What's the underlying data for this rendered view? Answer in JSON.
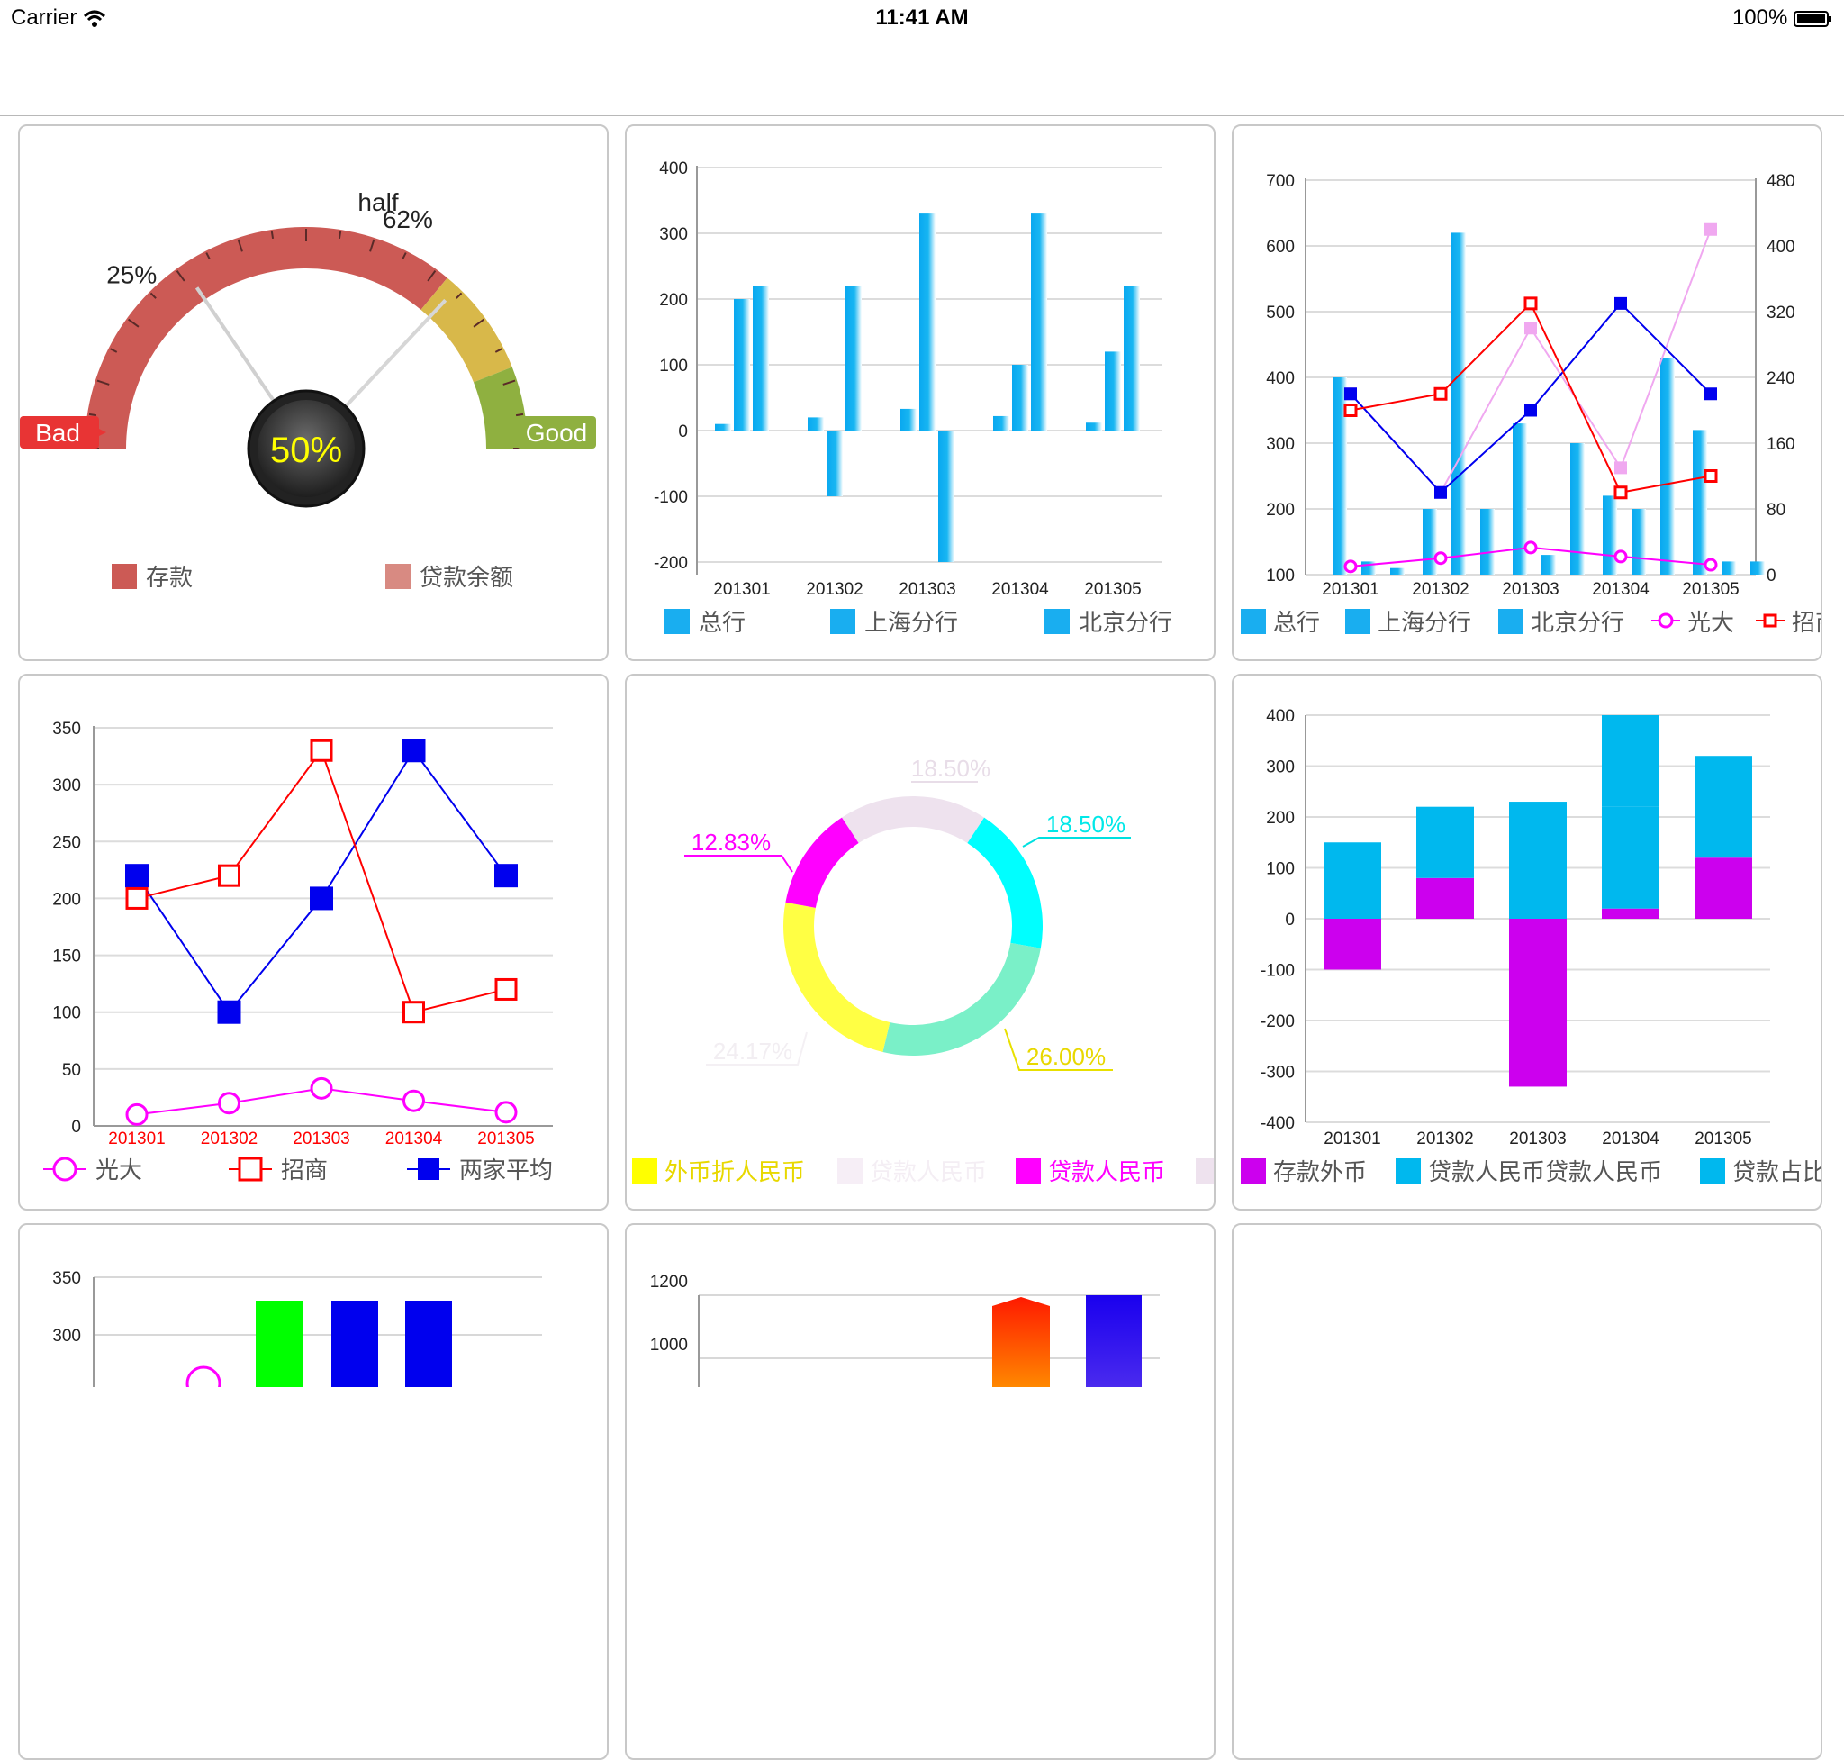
{
  "status_bar": {
    "carrier": "Carrier",
    "time": "11:41 AM",
    "battery": "100%"
  },
  "colors": {
    "gauge_red": "#cc5a55",
    "gauge_yellow": "#d8b84a",
    "gauge_green": "#8fb040",
    "bar_blue": "#19aef0",
    "series_red": "#ff0000",
    "series_blue": "#0000ee",
    "series_magenta": "#ff00ff",
    "series_pink": "#f0a8f0",
    "donut_magenta": "#ff00ff",
    "donut_cyan": "#00ffff",
    "donut_yellow": "#ffff00",
    "stack_purple": "#cc00ee",
    "stack_cyan": "#00b8ee",
    "green": "#00ff00"
  },
  "chart_data": [
    {
      "type": "gauge",
      "value": 50,
      "value_label": "50%",
      "tick_labels": [
        "25%",
        "half",
        "62%"
      ],
      "tick_values": [
        25,
        50,
        62
      ],
      "band_labels": {
        "left": "Bad",
        "right": "Good"
      },
      "legend": [
        "存款",
        "贷款余额"
      ]
    },
    {
      "type": "bar",
      "categories": [
        "201301",
        "201302",
        "201303",
        "201304",
        "201305"
      ],
      "series": [
        {
          "name": "总行",
          "values": [
            10,
            20,
            33,
            22,
            12
          ]
        },
        {
          "name": "上海分行",
          "values": [
            200,
            -100,
            330,
            100,
            120
          ]
        },
        {
          "name": "北京分行",
          "values": [
            220,
            220,
            -200,
            330,
            220
          ]
        }
      ],
      "ylim": [
        -200,
        400
      ],
      "yticks": [
        "400",
        "300",
        "200",
        "100",
        "0",
        "-100",
        "-200"
      ],
      "yticks_values": [
        400,
        300,
        200,
        100,
        0,
        -100,
        -200
      ]
    },
    {
      "type": "bar",
      "categories": [
        "201301",
        "201302",
        "201303",
        "201304",
        "201305"
      ],
      "series": [
        {
          "name": "总行",
          "values": [
            400,
            200,
            330,
            220,
            320
          ]
        },
        {
          "name": "上海分行",
          "values": [
            120,
            620,
            130,
            200,
            120
          ]
        },
        {
          "name": "北京分行",
          "values": [
            110,
            200,
            300,
            430,
            120
          ]
        },
        {
          "name": "光大",
          "values": [
            10,
            20,
            33,
            22,
            12
          ],
          "axis": "right"
        },
        {
          "name": "招商",
          "values": [
            200,
            220,
            330,
            100,
            120
          ],
          "axis": "right"
        },
        {
          "name": "",
          "values": [
            220,
            100,
            200,
            330,
            220
          ],
          "axis": "right"
        },
        {
          "name": "",
          "values": [
            220,
            100,
            300,
            130,
            420
          ],
          "axis": "right"
        }
      ],
      "ylim": [
        100,
        700
      ],
      "yticks": [
        "700",
        "600",
        "500",
        "400",
        "300",
        "200",
        "100"
      ],
      "yticks_values": [
        700,
        600,
        500,
        400,
        300,
        200,
        100
      ],
      "y2lim": [
        0,
        480
      ],
      "y2ticks": [
        "480",
        "400",
        "320",
        "240",
        "160",
        "80",
        "0"
      ],
      "y2ticks_values": [
        480,
        400,
        320,
        240,
        160,
        80,
        0
      ]
    },
    {
      "type": "line",
      "categories": [
        "201301",
        "201302",
        "201303",
        "201304",
        "201305"
      ],
      "series": [
        {
          "name": "光大",
          "values": [
            10,
            20,
            33,
            22,
            12
          ]
        },
        {
          "name": "招商",
          "values": [
            200,
            220,
            330,
            100,
            120
          ]
        },
        {
          "name": "两家平均",
          "values": [
            220,
            100,
            200,
            330,
            220
          ]
        }
      ],
      "ylim": [
        0,
        350
      ],
      "yticks": [
        "350",
        "300",
        "250",
        "200",
        "150",
        "100",
        "50",
        "0"
      ],
      "yticks_values": [
        350,
        300,
        250,
        200,
        150,
        100,
        50,
        0
      ]
    },
    {
      "type": "pie",
      "slices": [
        {
          "label": "18.50%",
          "value": 18.5,
          "color": "#eee2ee"
        },
        {
          "label": "18.50%",
          "value": 18.5,
          "color": "#00ffff"
        },
        {
          "label": "26.00%",
          "value": 26.0,
          "color": "#ffff00"
        },
        {
          "label": "24.17%",
          "value": 24.17,
          "color": "#ffff00"
        },
        {
          "label": "12.83%",
          "value": 12.83,
          "color": "#ff00ff"
        }
      ],
      "legend": [
        "外币折人民币",
        "贷款人民币",
        "贷款人民币"
      ]
    },
    {
      "type": "bar",
      "categories": [
        "201301",
        "201302",
        "201303",
        "201304",
        "201305"
      ],
      "series": [
        {
          "name": "存款外币",
          "values": [
            -100,
            80,
            -330,
            20,
            120
          ]
        },
        {
          "name": "贷款人民币贷款人民币",
          "values": [
            150,
            120,
            230,
            200,
            0
          ]
        },
        {
          "name": "贷款占比",
          "values": [
            0,
            20,
            0,
            180,
            200
          ]
        }
      ],
      "ylim": [
        -400,
        400
      ],
      "yticks": [
        "400",
        "300",
        "200",
        "100",
        "0",
        "-100",
        "-200",
        "-300",
        "-400"
      ],
      "yticks_values": [
        400,
        300,
        200,
        100,
        0,
        -100,
        -200,
        -300,
        -400
      ]
    },
    {
      "type": "bar",
      "yticks": [
        "350",
        "300"
      ],
      "yticks_values": [
        350,
        300
      ]
    },
    {
      "type": "bar",
      "yticks": [
        "1200",
        "1000"
      ],
      "yticks_values": [
        1200,
        1000
      ]
    }
  ]
}
